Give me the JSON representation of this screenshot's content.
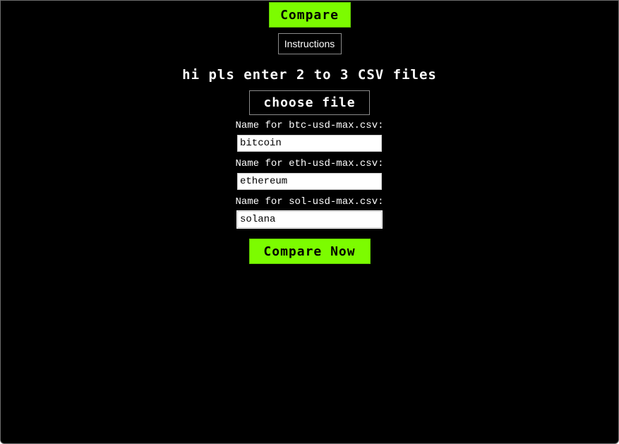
{
  "nav": {
    "compare_label": "Compare",
    "instructions_label": "Instructions"
  },
  "form": {
    "heading": "hi pls enter 2 to 3 CSV files",
    "choose_file_label": "choose file",
    "fields": [
      {
        "label": "Name for btc-usd-max.csv:",
        "value": "bitcoin"
      },
      {
        "label": "Name for eth-usd-max.csv:",
        "value": "ethereum"
      },
      {
        "label": "Name for sol-usd-max.csv:",
        "value": "solana"
      }
    ],
    "focused_field_index": 2,
    "submit_label": "Compare Now"
  },
  "colors": {
    "accent": "#7cfc00",
    "background": "#000000",
    "text": "#ffffff"
  }
}
